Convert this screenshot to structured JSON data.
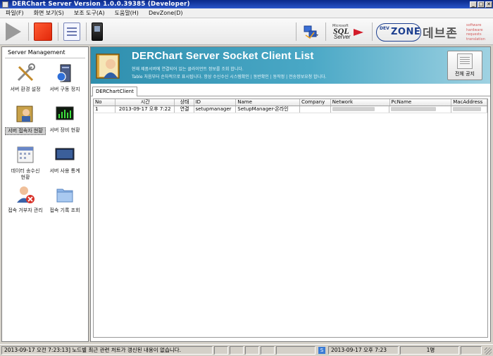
{
  "window": {
    "title": "DERChart Server Version 1.0.0.39385 (Developer)",
    "controls": [
      "_",
      "□",
      "✕"
    ]
  },
  "menu": [
    {
      "label": "파일(F)"
    },
    {
      "label": "화면 보기(S)"
    },
    {
      "label": "보조 도구(A)"
    },
    {
      "label": "도움말(H)"
    },
    {
      "label": "DevZone(D)"
    }
  ],
  "toolbar": {
    "buttons": [
      "play-icon",
      "stop-icon",
      "report-icon",
      "device-icon"
    ],
    "logos": {
      "sql_small": "Microsoft",
      "sql": "SQL",
      "server": "Server",
      "devzone_dev": "DEV",
      "devzone_zone": "ZONE",
      "korean": "데브존",
      "tag1": "software",
      "tag2": "hardware",
      "tag3": "requests",
      "tag4": "translation"
    }
  },
  "sidebar": {
    "header": "Server Management",
    "items": [
      {
        "label": "서버 환경 설정",
        "icon": "tools-icon"
      },
      {
        "label": "서버 구동 정지",
        "icon": "server-power-icon"
      },
      {
        "label": "서버 접속자 현황",
        "icon": "user-book-icon"
      },
      {
        "label": "서버 장비 현황",
        "icon": "monitor-chart-icon"
      },
      {
        "label": "데이터 송수신",
        "label2": "현황",
        "icon": "calendar-icon"
      },
      {
        "label": "서버 사용 통계",
        "icon": "display-icon"
      },
      {
        "label": "접속 거부자 관리",
        "icon": "user-denied-icon"
      },
      {
        "label": "접속 기록 조회",
        "icon": "folder-icon"
      }
    ]
  },
  "banner": {
    "title": "DERChart Server Socket Client List",
    "subtitle1": "현재 제품서버에 연결되어 있는 클라이언트 정보를 조회 합니다.",
    "subtitle2": "Table 처음부터 순차적으로 표시됩니다. 항상 수신수신 시스템확인 | 동반확인 | 동작정 | 전송정보요청 합니다.",
    "notice_button": "전체 공지"
  },
  "tab": {
    "label": "DERChartClient"
  },
  "grid": {
    "columns": [
      "No",
      "시간",
      "상태",
      "ID",
      "Name",
      "Company",
      "Network",
      "PcName",
      "MacAddress"
    ],
    "rows": [
      {
        "no": "1",
        "time": "2013-09-17 오후 7:22",
        "status": "연결",
        "id": "setupmanager",
        "name": "SetupManager-온라인",
        "company": "",
        "network": "",
        "pcname": "",
        "mac": ""
      }
    ]
  },
  "status": {
    "message": "2013-09-17 오전 7:23:13] 노드별 최근 관련 처트가 갱신된 내용이 없습니다.",
    "icon_label": "S",
    "datetime": "2013-09-17 오후 7:23",
    "count": "1명"
  },
  "colors": {
    "banner_start": "#2f8fae",
    "banner_end": "#9fd2e2",
    "stop_red": "#e2280a",
    "titlebar": "#0b2a8a"
  }
}
